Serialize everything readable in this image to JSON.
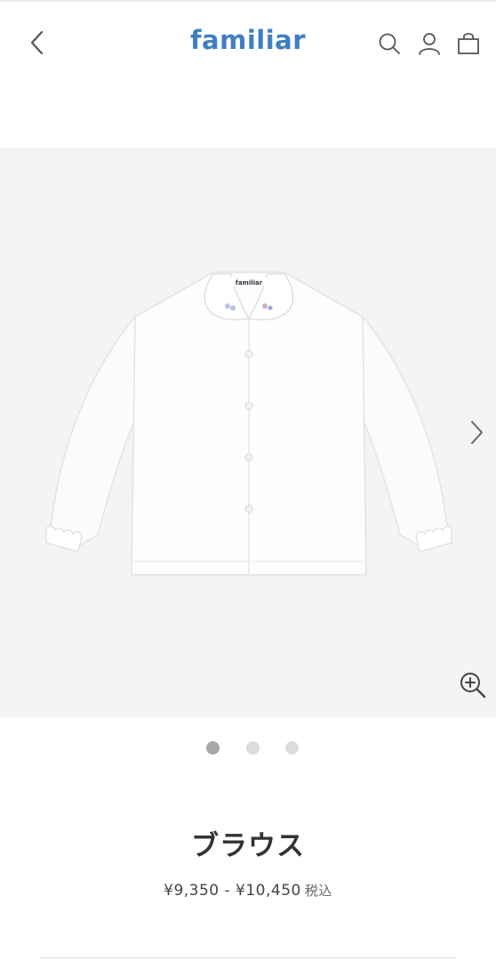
{
  "header": {
    "logo": "familiar",
    "back_icon": "chevron-left-icon",
    "search_icon": "search-icon",
    "account_icon": "user-icon",
    "cart_icon": "shopping-bag-icon",
    "logo_color": "#3f7fc0"
  },
  "gallery": {
    "next_icon": "chevron-right-icon",
    "zoom_icon": "zoom-in-icon",
    "background": "#f4f4f4",
    "total_images": 3,
    "active_index": 1,
    "label_text": "familiar"
  },
  "product": {
    "name": "ブラウス",
    "price_range": "¥9,350 - ¥10,450",
    "tax_label": "税込"
  }
}
